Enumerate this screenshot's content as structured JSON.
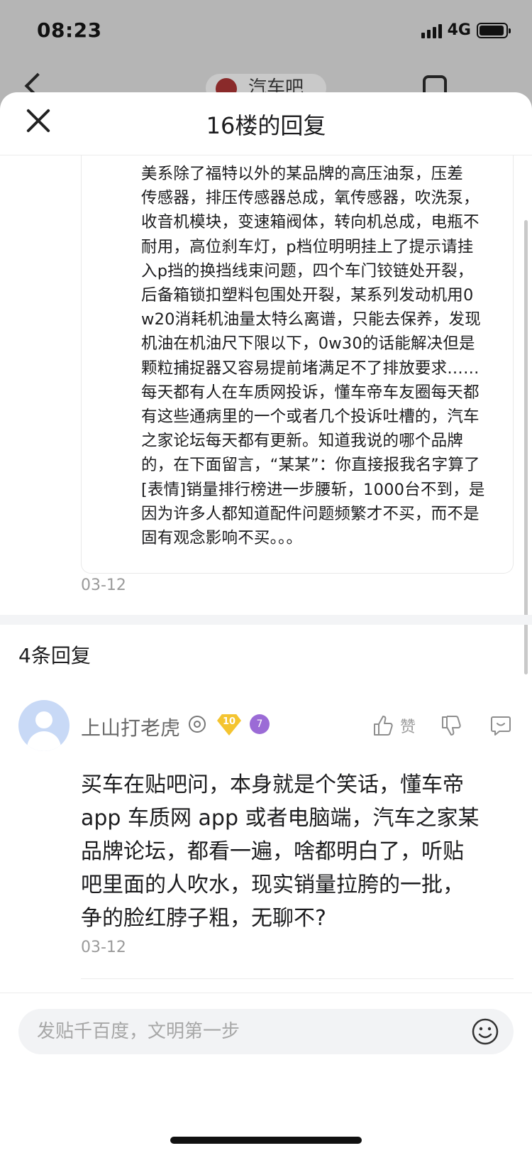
{
  "status_bar": {
    "time": "08:23",
    "network": "4G"
  },
  "underlying_page": {
    "forum_tag": "汽车吧"
  },
  "sheet": {
    "title": "16楼的回复",
    "quoted_post": {
      "text": "美系除了福特以外的某品牌的高压油泵，压差\n传感器，排压传感器总成，氧传感器，吹洗泵，\n收音机模块，变速箱阀体，转向机总成，电瓶不\n耐用，高位刹车灯，p档位明明挂上了提示请挂\n入p挡的换挡线束问题，四个车门铰链处开裂，\n后备箱锁扣塑料包围处开裂，某系列发动机用0\nw20消耗机油量太特么离谱，只能去保养，发现\n机油在机油尺下限以下，0w30的话能解决但是\n颗粒捕捉器又容易提前堵满足不了排放要求……\n每天都有人在车质网投诉，懂车帝车友圈每天都\n有这些通病里的一个或者几个投诉吐槽的，汽车\n之家论坛每天都有更新。知道我说的哪个品牌\n的，在下面留言，“某某”：你直接报我名字算了\n[表情]销量排行榜进一步腰斩，1000台不到，是\n因为许多人都知道配件问题频繁才不买，而不是\n固有观念影响不买。。。",
      "date": "03-12"
    },
    "reply_count": "4条回复",
    "replies": [
      {
        "username": "上山打老虎",
        "level": "10",
        "fan_level": "7",
        "like_label": "赞",
        "text": "买车在贴吧问，本身就是个笑话，懂车帝\napp 车质网 app 或者电脑端，汽车之家某\n品牌论坛，都看一遍，啥都明白了，听贴\n吧里面的人吹水，现实销量拉胯的一批，\n争的脸红脖子粗，无聊不?",
        "date": "03-12"
      }
    ],
    "input": {
      "placeholder": "发贴千百度，文明第一步"
    }
  },
  "icons": [
    "close-icon",
    "thumbs-up-icon",
    "thumbs-down-icon",
    "comment-icon",
    "emoji-icon",
    "verified-icon"
  ]
}
